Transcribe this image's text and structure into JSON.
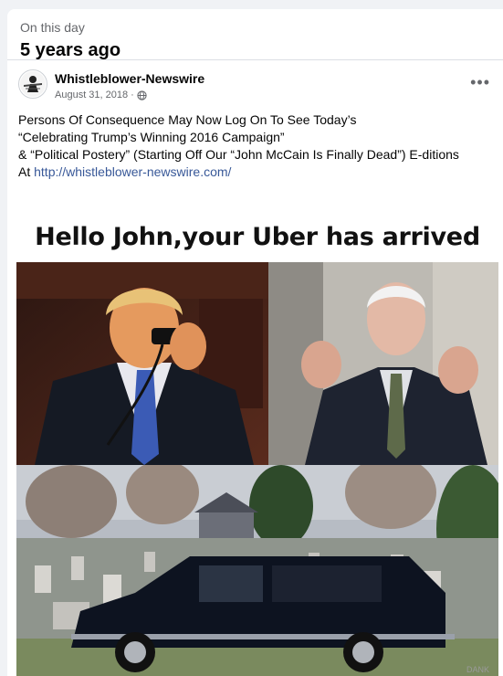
{
  "memory": {
    "label": "On this day",
    "title": "5 years ago"
  },
  "post": {
    "author": "Whistleblower-Newswire",
    "date": "August 31, 2018 ·",
    "privacy_icon": "globe-icon",
    "more_icon": "more-options-icon",
    "more_label": "•••",
    "lines": [
      "Persons Of Consequence May Now Log On To See Today’s",
      "“Celebrating Trump’s Winning 2016 Campaign”",
      "& “Political Postery” (Starting Off Our “John McCain Is Finally Dead”) E-ditions"
    ],
    "link_prefix": "At ",
    "link_text": "http://whistleblower-newswire.com/"
  },
  "meme": {
    "caption": "Hello John,your Uber has arrived",
    "watermark": "DANK"
  },
  "colors": {
    "background": "#f0f2f5",
    "card": "#ffffff",
    "link": "#385898",
    "secondary_text": "#65676b"
  }
}
